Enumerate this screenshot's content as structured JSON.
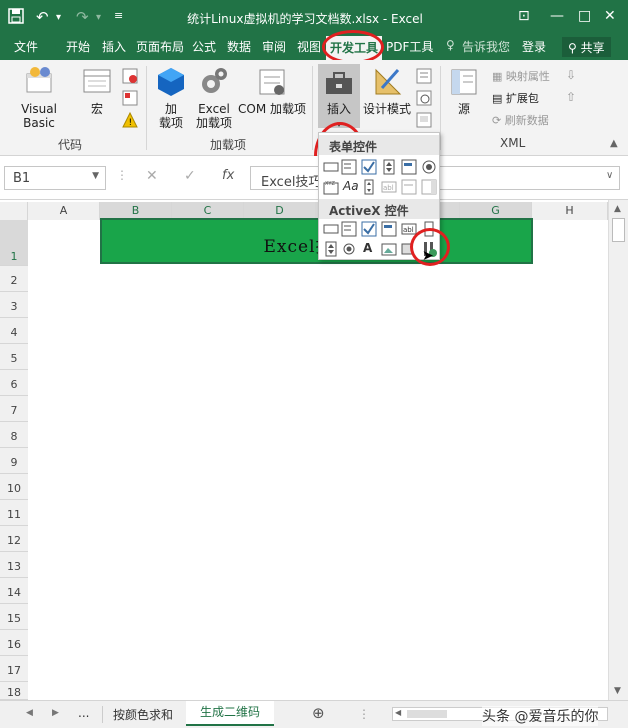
{
  "window": {
    "title": "统计Linux虚拟机的学习文档数.xlsx - Excel"
  },
  "tabs": [
    {
      "label": "文件"
    },
    {
      "label": "开始"
    },
    {
      "label": "插入"
    },
    {
      "label": "页面布局"
    },
    {
      "label": "公式"
    },
    {
      "label": "数据"
    },
    {
      "label": "审阅"
    },
    {
      "label": "视图"
    },
    {
      "label": "开发工具"
    },
    {
      "label": "PDF工具"
    }
  ],
  "tellme": "告诉我您",
  "signin": "登录",
  "share": "共享",
  "ribbon": {
    "code_group": {
      "label": "代码",
      "visual_basic": "Visual Basic",
      "macro": "宏"
    },
    "addins_group": {
      "label": "加载项",
      "addins_line1": "加",
      "addins_line2": "载项",
      "excel_addins_line1": "Excel",
      "excel_addins_line2": "加载项",
      "com_addins": "COM 加载项"
    },
    "controls_group": {
      "insert": "插入",
      "design_mode": "设计模式"
    },
    "xml_group": {
      "label": "XML",
      "source": "源",
      "map_props": "映射属性",
      "expansion_packs": "扩展包",
      "refresh_data": "刷新数据"
    }
  },
  "formula": {
    "namebox": "B1",
    "fx": "fx",
    "content": "Excel技巧"
  },
  "dropdown": {
    "form_controls_title": "表单控件",
    "activex_title": "ActiveX 控件"
  },
  "grid": {
    "columns": [
      "A",
      "B",
      "C",
      "D",
      "E",
      "F",
      "G",
      "H"
    ],
    "rows": [
      "1",
      "2",
      "3",
      "4",
      "5",
      "6",
      "7",
      "8",
      "9",
      "10",
      "11",
      "12",
      "13",
      "14",
      "15",
      "16",
      "17",
      "18"
    ],
    "b1_text": "Excel技巧："
  },
  "sheets": {
    "ellipsis": "...",
    "sheet1": "按颜色求和",
    "sheet2": "生成二维码"
  },
  "watermark": "头条 @爱音乐的你",
  "colors": {
    "excel_green": "#217346",
    "cell_fill": "#19a54a",
    "highlight_red": "#e02020"
  }
}
